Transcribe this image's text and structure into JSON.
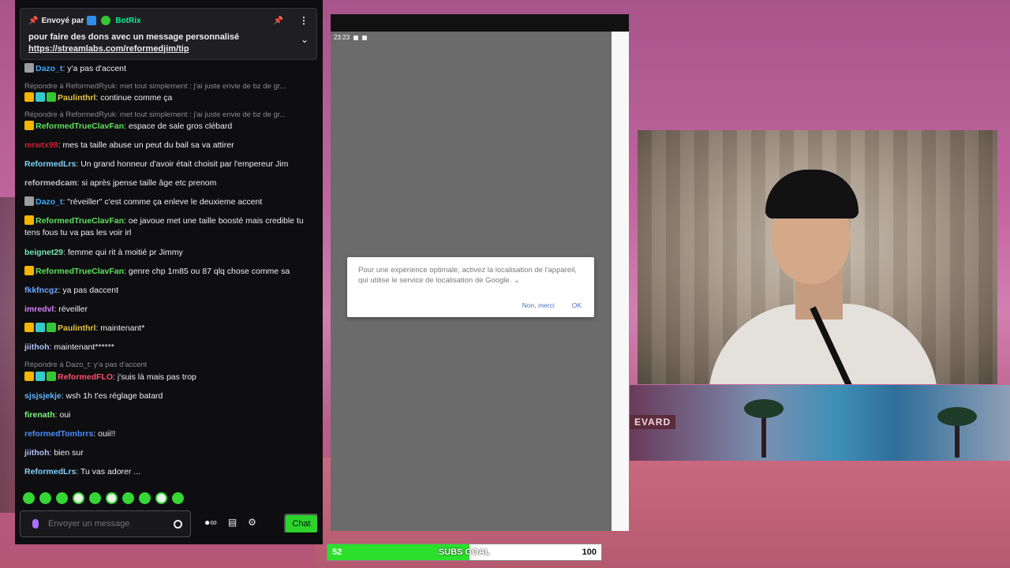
{
  "pinned": {
    "prefix": "Envoyé par",
    "bot": "BotRix",
    "text": "pour faire des dons avec un message personnalisé",
    "link": "https://streamlabs.com/reformedjim/tip"
  },
  "messages": [
    {
      "user": "Dazo_t",
      "text": ": y'a pas d'accent",
      "color": "#3fa9f5",
      "badges": [
        "grey"
      ]
    },
    {
      "reply": "Répondre à ReformedRyuk: met tout simplement : j'ai juste envie de bz de gr..."
    },
    {
      "user": "Paulinthrl",
      "text": ": continue comme ça",
      "color": "#e6c445",
      "badges": [
        "yellow",
        "teal",
        "green"
      ]
    },
    {
      "reply": "Répondre à ReformedRyuk: met tout simplement : j'ai juste envie de bz de gr..."
    },
    {
      "user": "ReformedTrueClavFan",
      "text": ": espace de sale gros clébard",
      "color": "#5ee05e",
      "badges": [
        "yellow"
      ]
    },
    {
      "user": "mrwtx98",
      "text": ": mes ta taille abuse un peut du bail sa va attirer",
      "color": "#c6202f",
      "badges": []
    },
    {
      "user": "ReformedLrs",
      "text": ": Un grand honneur d'avoir était choisit par l'empereur Jim",
      "color": "#7fd1ff",
      "badges": []
    },
    {
      "user": "reformedcam",
      "text": ": si après jpense taille âge etc prenom",
      "color": "#c0c0c8",
      "badges": []
    },
    {
      "user": "Dazo_t",
      "text": ": \"réveiller\" c'est comme ça enleve le deuxieme accent",
      "color": "#3fa9f5",
      "badges": [
        "grey"
      ]
    },
    {
      "user": "ReformedTrueClavFan",
      "text": ": oe javoue met une taille boosté mais credible tu tens fous tu va pas les voir irl",
      "color": "#5ee05e",
      "badges": [
        "yellow"
      ]
    },
    {
      "user": "beignet29",
      "text": ": femme qui rit à moitié pr Jimmy",
      "color": "#74e6b5",
      "badges": []
    },
    {
      "user": "ReformedTrueClavFan",
      "text": ": genre chp 1m85 ou 87 qlq chose comme sa",
      "color": "#5ee05e",
      "badges": [
        "yellow"
      ]
    },
    {
      "user": "fkkfncgz",
      "text": ": ya pas daccent",
      "color": "#6aa8ff",
      "badges": []
    },
    {
      "user": "imredvl",
      "text": ": réveiller",
      "color": "#d580ff",
      "badges": []
    },
    {
      "user": "Paulinthrl",
      "text": ": maintenant*",
      "color": "#e6c445",
      "badges": [
        "yellow",
        "teal",
        "green"
      ]
    },
    {
      "user": "jiithoh",
      "text": ": maintenant******",
      "color": "#b0c4ff",
      "badges": []
    },
    {
      "reply": "Répondre à Dazo_t: y'a pas d'accent"
    },
    {
      "user": "ReformedFLO",
      "text": ": j'suis là mais pas trop",
      "color": "#ff4f6a",
      "badges": [
        "yellow",
        "teal",
        "green"
      ]
    },
    {
      "user": "sjsjsjekje",
      "text": ": wsh 1h t'es réglage batard",
      "color": "#5fb5ff",
      "badges": []
    },
    {
      "user": "firenath",
      "text": ": oui",
      "color": "#7ff07f",
      "badges": []
    },
    {
      "user": "reformedTombrrs",
      "text": ": ouii!!",
      "color": "#4c8cff",
      "badges": []
    },
    {
      "user": "jiithoh",
      "text": ": bien sur",
      "color": "#b0c4ff",
      "badges": []
    },
    {
      "user": "ReformedLrs",
      "text": ": Tu vas adorer ...",
      "color": "#7fd1ff",
      "badges": []
    }
  ],
  "input": {
    "placeholder": "Envoyer un message",
    "chat_button": "Chat"
  },
  "phone": {
    "time": "23:23",
    "dialog_text": "Pour une expérience optimale, activez la localisation de l'appareil, qui utilise le service de localisation de Google.",
    "dialog_chevron": "⌄",
    "dismiss": "Non, merci",
    "ok": "OK"
  },
  "background": {
    "sign": "EVARD"
  },
  "goal": {
    "current": "52",
    "label": "SUBS GOAL",
    "target": "100",
    "progress": 0.52
  }
}
